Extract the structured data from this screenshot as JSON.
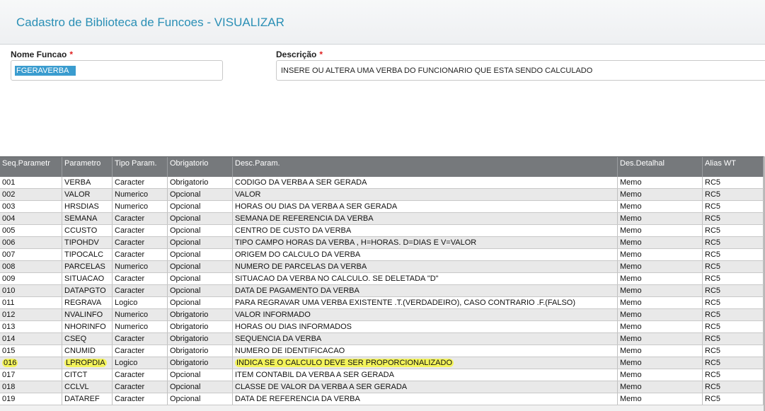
{
  "window": {
    "title": "Cadastro de Biblioteca de Funcoes - VISUALIZAR"
  },
  "form": {
    "nome_funcao": {
      "label": "Nome Funcao",
      "required": "*",
      "value": "FGERAVERBA"
    },
    "descricao": {
      "label": "Descrição",
      "required": "*",
      "value": "INSERE OU ALTERA UMA VERBA DO FUNCIONARIO QUE ESTA SENDO CALCULADO"
    }
  },
  "grid": {
    "columns": [
      "Seq.Parametr",
      "Parametro",
      "Tipo Param.",
      "Obrigatorio",
      "Desc.Param.",
      "Des.Detalhal",
      "Alias WT"
    ],
    "rows": [
      [
        "001",
        "VERBA",
        "Caracter",
        "Obrigatorio",
        "CODIGO DA VERBA A SER GERADA",
        "Memo",
        "RC5"
      ],
      [
        "002",
        "VALOR",
        "Numerico",
        "Opcional",
        "VALOR",
        "Memo",
        "RC5"
      ],
      [
        "003",
        "HRSDIAS",
        "Numerico",
        "Opcional",
        "HORAS OU DIAS DA VERBA A SER GERADA",
        "Memo",
        "RC5"
      ],
      [
        "004",
        "SEMANA",
        "Caracter",
        "Opcional",
        "SEMANA DE REFERENCIA DA VERBA",
        "Memo",
        "RC5"
      ],
      [
        "005",
        "CCUSTO",
        "Caracter",
        "Opcional",
        "CENTRO DE CUSTO DA VERBA",
        "Memo",
        "RC5"
      ],
      [
        "006",
        "TIPOHDV",
        "Caracter",
        "Opcional",
        "TIPO CAMPO HORAS DA VERBA , H=HORAS. D=DIAS E V=VALOR",
        "Memo",
        "RC5"
      ],
      [
        "007",
        "TIPOCALC",
        "Caracter",
        "Opcional",
        "ORIGEM DO CALCULO DA VERBA",
        "Memo",
        "RC5"
      ],
      [
        "008",
        "PARCELAS",
        "Numerico",
        "Opcional",
        "NUMERO DE PARCELAS DA VERBA",
        "Memo",
        "RC5"
      ],
      [
        "009",
        "SITUACAO",
        "Caracter",
        "Opcional",
        "SITUACAO DA VERBA NO CALCULO. SE DELETADA \"D\"",
        "Memo",
        "RC5"
      ],
      [
        "010",
        "DATAPGTO",
        "Caracter",
        "Opcional",
        "DATA DE PAGAMENTO DA VERBA",
        "Memo",
        "RC5"
      ],
      [
        "011",
        "REGRAVA",
        "Logico",
        "Opcional",
        "PARA REGRAVAR UMA VERBA EXISTENTE .T.(VERDADEIRO), CASO CONTRARIO .F.(FALSO)",
        "Memo",
        "RC5"
      ],
      [
        "012",
        "NVALINFO",
        "Numerico",
        "Obrigatorio",
        "VALOR INFORMADO",
        "Memo",
        "RC5"
      ],
      [
        "013",
        "NHORINFO",
        "Numerico",
        "Obrigatorio",
        "HORAS OU DIAS INFORMADOS",
        "Memo",
        "RC5"
      ],
      [
        "014",
        "CSEQ",
        "Caracter",
        "Obrigatorio",
        "SEQUENCIA DA VERBA",
        "Memo",
        "RC5"
      ],
      [
        "015",
        "CNUMID",
        "Caracter",
        "Obrigatorio",
        "NUMERO DE IDENTIFICACAO",
        "Memo",
        "RC5"
      ],
      [
        "016",
        "LPROPDIA",
        "Logico",
        "Obrigatorio",
        "INDICA SE O CALCULO DEVE SER PROPORCIONALIZADO",
        "Memo",
        "RC5"
      ],
      [
        "017",
        "CITCT",
        "Caracter",
        "Opcional",
        "ITEM CONTABIL DA VERBA A SER GERADA",
        "Memo",
        "RC5"
      ],
      [
        "018",
        "CCLVL",
        "Caracter",
        "Opcional",
        "CLASSE DE VALOR DA VERBA A SER GERADA",
        "Memo",
        "RC5"
      ],
      [
        "019",
        "DATAREF",
        "Caracter",
        "Opcional",
        "DATA DE REFERENCIA DA VERBA",
        "Memo",
        "RC5"
      ]
    ],
    "highlighted_row": "016",
    "highlight_color": "#f3f35a"
  }
}
